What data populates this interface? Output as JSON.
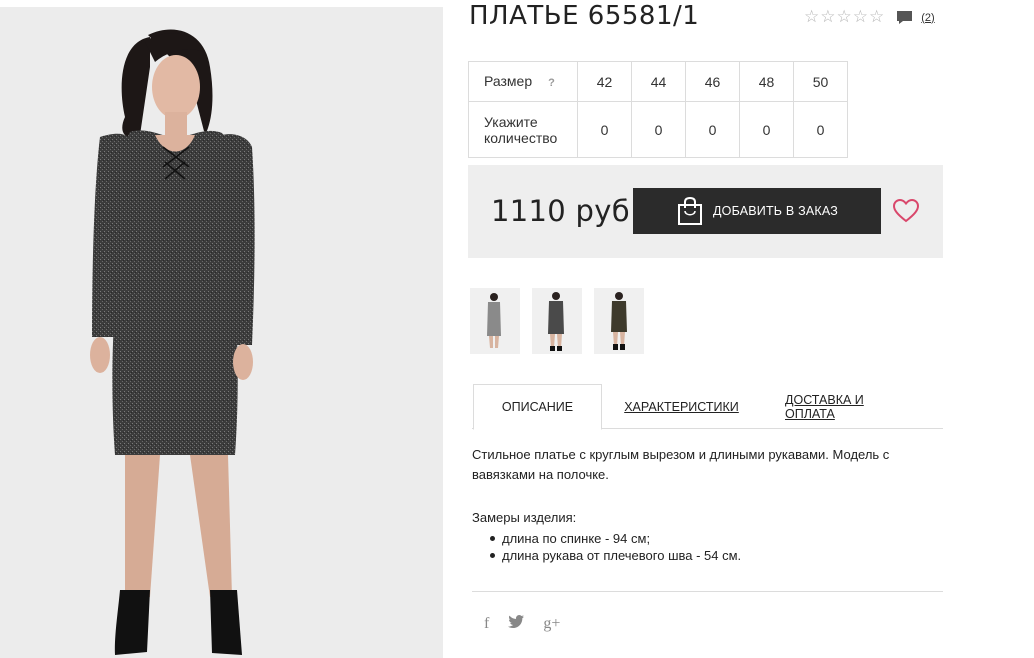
{
  "product": {
    "title": "ПЛАТЬЕ 65581/1",
    "rating_stars": 5,
    "rating_filled": 0,
    "reviews_count": "(2)"
  },
  "sizes": {
    "row_label": "Размер",
    "help": "?",
    "values": [
      "42",
      "44",
      "46",
      "48",
      "50"
    ],
    "qty_label": "Укажите количество",
    "quantities": [
      "0",
      "0",
      "0",
      "0",
      "0"
    ]
  },
  "purchase": {
    "price": "1110 руб",
    "add_button": "ДОБАВИТЬ В ЗАКАЗ"
  },
  "tabs": [
    {
      "label": "ОПИСАНИЕ",
      "active": true
    },
    {
      "label": "ХАРАКТЕРИСТИКИ",
      "active": false
    },
    {
      "label": "ДОСТАВКА И ОПЛАТА",
      "active": false
    }
  ],
  "description": {
    "text": "Стильное платье с круглым вырезом и длиными рукавами. Модель с вавязками на полочке.",
    "measurements_title": "Замеры изделия:",
    "measurements": [
      "длина по спинке - 94 см;",
      "длина рукава от плечевого шва - 54 см."
    ]
  },
  "social": [
    {
      "icon": "facebook-icon",
      "glyph": "f"
    },
    {
      "icon": "twitter-icon",
      "glyph": "t"
    },
    {
      "icon": "google-plus-icon",
      "glyph": "g+"
    }
  ],
  "colors": {
    "button": "#2b2b2b",
    "heart": "#d9476b",
    "pricebox": "#eeeeee",
    "dress": "#3a3a3a"
  }
}
